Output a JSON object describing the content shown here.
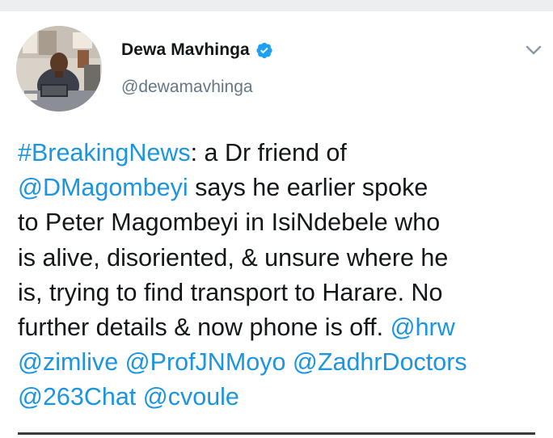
{
  "tweet": {
    "author": {
      "display_name": "Dewa Mavhinga",
      "handle": "@dewamavhinga",
      "verified": true
    },
    "lines": [
      [
        {
          "type": "hashtag",
          "text": "#BreakingNews"
        },
        {
          "type": "text",
          "text": ": a Dr friend of"
        }
      ],
      [
        {
          "type": "mention",
          "text": "@DMagombeyi"
        },
        {
          "type": "text",
          "text": " says he earlier spoke"
        }
      ],
      [
        {
          "type": "text",
          "text": "to Peter Magombeyi in IsiNdebele who"
        }
      ],
      [
        {
          "type": "text",
          "text": "is alive, disoriented, & unsure where he"
        }
      ],
      [
        {
          "type": "text",
          "text": "is, trying to find transport to Harare. No"
        }
      ],
      [
        {
          "type": "text",
          "text": "further details & now phone is off. "
        },
        {
          "type": "mention",
          "text": "@hrw"
        }
      ],
      [
        {
          "type": "mention",
          "text": "@zimlive"
        },
        {
          "type": "text",
          "text": " "
        },
        {
          "type": "mention",
          "text": "@ProfJNMoyo"
        },
        {
          "type": "text",
          "text": " "
        },
        {
          "type": "mention",
          "text": "@ZadhrDoctors"
        }
      ],
      [
        {
          "type": "mention",
          "text": "@263Chat"
        },
        {
          "type": "text",
          "text": " "
        },
        {
          "type": "mention",
          "text": "@cvoule"
        }
      ]
    ]
  },
  "icons": {
    "verified": "verified-badge-icon",
    "menu": "chevron-down-icon"
  },
  "colors": {
    "link": "#1b95e0",
    "verified": "#1da1f2",
    "text": "#14171a",
    "secondary": "#657786"
  }
}
